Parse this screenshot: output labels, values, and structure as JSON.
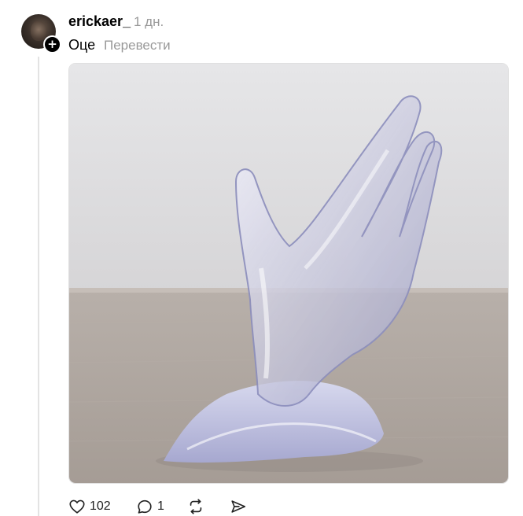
{
  "post": {
    "username": "erickaer_",
    "time": "1 дн.",
    "text": "Оце",
    "translate_label": "Перевести",
    "image_alt": "Прозора скульптура руки",
    "follow_badge": "+"
  },
  "actions": {
    "likes": "102",
    "replies": "1"
  },
  "icons": {
    "like": "heart-icon",
    "reply": "comment-icon",
    "repost": "repost-icon",
    "share": "send-icon"
  }
}
